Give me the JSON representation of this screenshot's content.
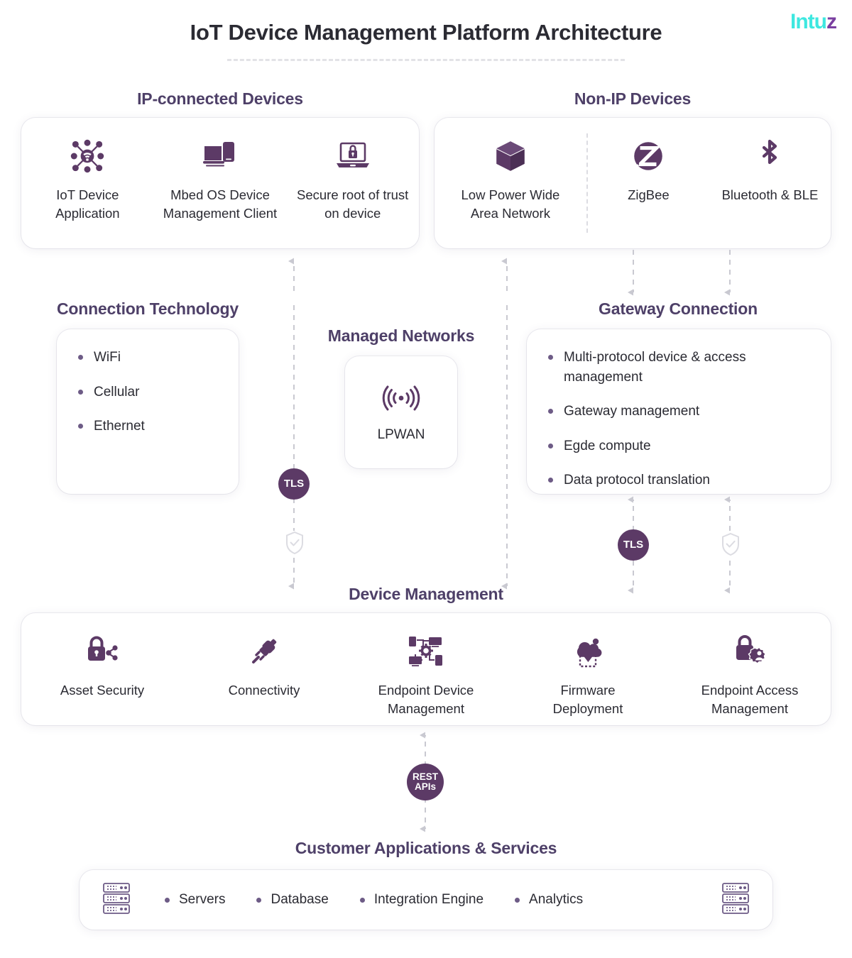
{
  "header": {
    "title": "IoT Device Management Platform Architecture",
    "logo_text": "Intu",
    "logo_accent": "z",
    "logo_color": "#3ee8e0",
    "logo_accent_color": "#7a3fa0"
  },
  "colors": {
    "heading": "#4e4068",
    "badge_bg": "#5c3a66",
    "icon": "#5c3a66",
    "bullet": "#6d5b86",
    "connector": "#c9c9d1",
    "card_bg": "#ffffff",
    "page_bg": "#ffffff"
  },
  "sections": {
    "ip_devices": {
      "title": "IP-connected Devices",
      "tiles": [
        {
          "icon": "iot-network-icon",
          "label": "IoT Device Application"
        },
        {
          "icon": "mbed-device-icon",
          "label": "Mbed OS Device Management Client"
        },
        {
          "icon": "secure-laptop-lock-icon",
          "label": "Secure root of trust on device"
        }
      ]
    },
    "non_ip_devices": {
      "title": "Non-IP Devices",
      "tiles": [
        {
          "icon": "cube-icon",
          "label": "Low Power Wide Area Network"
        },
        {
          "icon": "zigbee-icon",
          "label": "ZigBee"
        },
        {
          "icon": "bluetooth-icon",
          "label": "Bluetooth & BLE"
        }
      ]
    },
    "connection_technology": {
      "title": "Connection Technology",
      "items": [
        "WiFi",
        "Cellular",
        "Ethernet"
      ]
    },
    "managed_networks": {
      "title": "Managed Networks",
      "tile": {
        "icon": "signal-waves-icon",
        "label": "LPWAN"
      }
    },
    "gateway_connection": {
      "title": "Gateway Connection",
      "items": [
        "Multi-protocol device & access management",
        "Gateway management",
        "Egde compute",
        "Data protocol translation"
      ]
    },
    "device_management": {
      "title": "Device Management",
      "tiles": [
        {
          "icon": "asset-security-lock-icon",
          "label": "Asset Security"
        },
        {
          "icon": "plug-connector-icon",
          "label": "Connectivity"
        },
        {
          "icon": "endpoint-devices-gear-icon",
          "label": "Endpoint Device Management"
        },
        {
          "icon": "cloud-download-firmware-icon",
          "label": "Firmware Deployment"
        },
        {
          "icon": "lock-user-badge-icon",
          "label": "Endpoint Access Management"
        }
      ]
    },
    "customer_applications": {
      "title": "Customer Applications & Services",
      "left_icon": "server-rack-icon",
      "right_icon": "server-rack-icon",
      "items": [
        "Servers",
        "Database",
        "Integration Engine",
        "Analytics"
      ]
    }
  },
  "badges": {
    "tls_left": "TLS",
    "tls_right": "TLS",
    "rest_apis_line1": "REST",
    "rest_apis_line2": "APIs"
  },
  "security_icons": {
    "left_shield": "shield-check-icon",
    "right_shield": "shield-check-icon"
  }
}
